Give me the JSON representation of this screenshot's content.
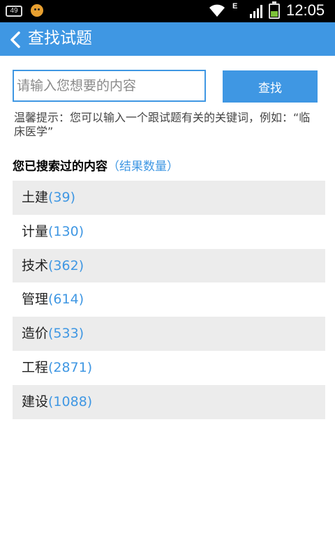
{
  "statusbar": {
    "badge": "49",
    "network": "E",
    "time": "12:05",
    "icons": [
      "notification-badge-icon",
      "emoji-face-icon",
      "wifi-icon",
      "signal-icon",
      "battery-charging-icon"
    ]
  },
  "header": {
    "title": "查找试题",
    "back_icon": "chevron-left-icon",
    "color": "#3f97e3"
  },
  "search": {
    "placeholder": "请输入您想要的内容",
    "value": "",
    "button_label": "查找"
  },
  "hint": "温馨提示：您可以输入一个跟试题有关的关键词，例如：“临床医学”",
  "history": {
    "title": "您已搜索过的内容",
    "note": "（结果数量）",
    "items": [
      {
        "label": "土建",
        "count": "(39)"
      },
      {
        "label": "计量",
        "count": "(130)"
      },
      {
        "label": "技术",
        "count": "(362)"
      },
      {
        "label": "管理",
        "count": "(614)"
      },
      {
        "label": "造价",
        "count": "(533)"
      },
      {
        "label": "工程",
        "count": "(2871)"
      },
      {
        "label": "建设",
        "count": "(1088)"
      }
    ]
  }
}
